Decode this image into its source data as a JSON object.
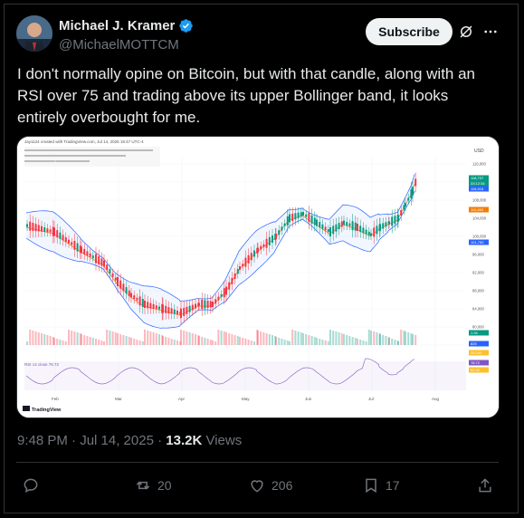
{
  "author": {
    "name": "Michael J. Kramer",
    "handle": "@MichaelMOTTCM"
  },
  "header": {
    "subscribe_label": "Subscribe"
  },
  "tweet": {
    "text": "I don't normally opine on Bitcoin, but with that candle, along with an RSI over 75 and trading above its upper Bollinger band, it looks entirely overbought for me.",
    "time": "9:48 PM · Jul 14, 2025 · ",
    "views_count": "13.2K",
    "views_label": " Views"
  },
  "actions": {
    "replies": "",
    "reposts": "20",
    "likes": "206",
    "bookmarks": "17"
  },
  "chart": {
    "created_with": "Jay1124 created with TradingView.com, Jul 14, 2025 19:47 UTC-4",
    "currency": "USD",
    "price_labels": [
      "116,000",
      "112,000",
      "108,000",
      "104,000",
      "100,000",
      "96,000",
      "92,000",
      "88,000",
      "84,000",
      "80,000",
      "76,000"
    ],
    "months": [
      "Feb",
      "Mar",
      "Apr",
      "May",
      "Jun",
      "Jul",
      "Aug"
    ],
    "tags": [
      {
        "text": "118,707",
        "color": "#089981"
      },
      {
        "text": "33:12:34",
        "color": "#089981"
      },
      {
        "text": "118,515",
        "color": "#2962ff"
      },
      {
        "text": "110,893",
        "color": "#f57c00"
      },
      {
        "text": "101,750",
        "color": "#2962ff"
      },
      {
        "text": "1.94",
        "color": "#089981"
      },
      {
        "text": "825",
        "color": "#2962ff"
      },
      {
        "text": "26.240",
        "color": "#fbc02d"
      },
      {
        "text": "78.72",
        "color": "#7e57c2"
      },
      {
        "text": "62.42",
        "color": "#fbc02d"
      }
    ],
    "rsi_label": "RSI 14 close 78.72",
    "logo_text": "TradingView",
    "colors": {
      "up": "#089981",
      "down": "#f23645",
      "band": "#2962ff",
      "basis": "#f57c00",
      "rsi": "#7e57c2"
    }
  }
}
